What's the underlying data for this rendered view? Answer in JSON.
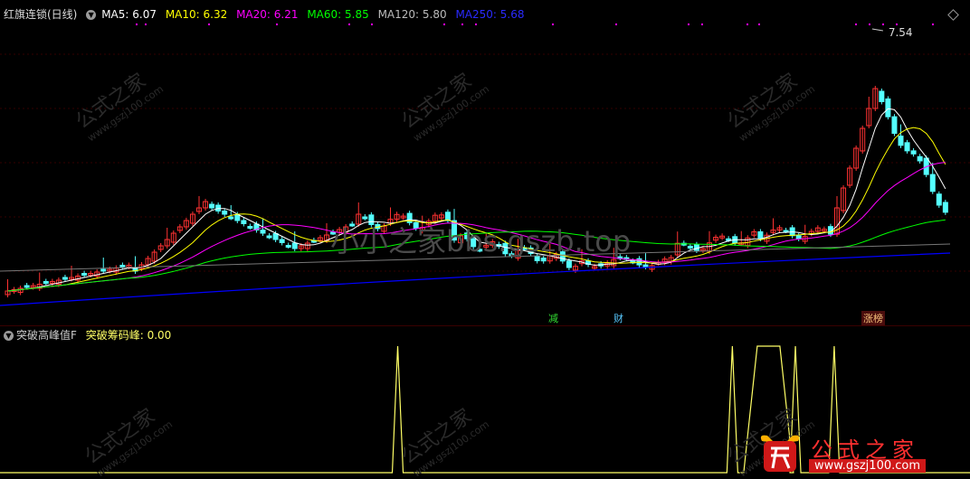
{
  "main_header": {
    "title": "红旗连锁(日线)",
    "ma5": "MA5: 6.07",
    "ma10": "MA10: 6.32",
    "ma20": "MA20: 6.21",
    "ma60": "MA60: 5.85",
    "ma120": "MA120: 5.80",
    "ma250": "MA250: 5.68"
  },
  "price_label": "7.54",
  "tags": {
    "jian": "减",
    "cai": "财",
    "zhang": "涨榜"
  },
  "sub_header": {
    "name": "突破高峰值F",
    "value": "突破筹码峰: 0.00"
  },
  "watermark": {
    "text": "公式之家",
    "url": "www.gszj100.com",
    "forum": "小小之家bbs.gszb.top"
  },
  "brand": {
    "name": "公式之家",
    "url": "www.gszj100.com"
  },
  "colors": {
    "up": "#ff3232",
    "down": "#54ffff",
    "ma5": "#ffffff",
    "ma10": "#ffff00",
    "ma20": "#ff00ff",
    "ma60": "#00ff00",
    "ma120": "#bbbbbb",
    "ma250": "#0000ff",
    "indicator": "#ffff66"
  },
  "chart_data": [
    {
      "type": "candlestick",
      "series": [
        {
          "name": "MA5"
        },
        {
          "name": "MA10"
        },
        {
          "name": "MA20"
        },
        {
          "name": "MA60"
        },
        {
          "name": "MA120"
        },
        {
          "name": "MA250"
        }
      ],
      "max_label": "7.54"
    },
    {
      "type": "line",
      "series": [
        {
          "name": "突破筹码峰"
        }
      ],
      "spikes": [
        0.41,
        0.755,
        0.79,
        0.82,
        0.86
      ]
    }
  ]
}
